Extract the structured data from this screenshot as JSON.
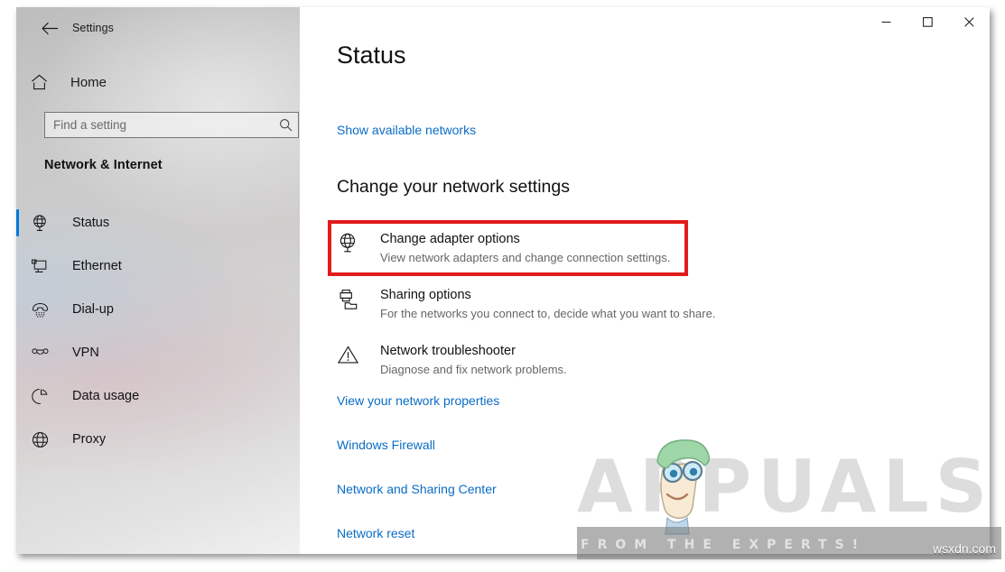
{
  "window": {
    "app_title": "Settings",
    "back_icon": "back-arrow-icon",
    "controls": {
      "minimize": "minimize-icon",
      "maximize": "maximize-icon",
      "close": "close-icon"
    }
  },
  "sidebar": {
    "home_label": "Home",
    "home_icon": "home-icon",
    "search": {
      "placeholder": "Find a setting",
      "value": "",
      "icon": "search-icon"
    },
    "category": "Network & Internet",
    "items": [
      {
        "label": "Status",
        "icon": "globe-monitor-icon",
        "selected": true
      },
      {
        "label": "Ethernet",
        "icon": "ethernet-icon",
        "selected": false
      },
      {
        "label": "Dial-up",
        "icon": "dialup-phone-icon",
        "selected": false
      },
      {
        "label": "VPN",
        "icon": "vpn-key-icon",
        "selected": false
      },
      {
        "label": "Data usage",
        "icon": "pie-chart-icon",
        "selected": false
      },
      {
        "label": "Proxy",
        "icon": "globe-icon",
        "selected": false
      }
    ],
    "accent_color": "#0078d7"
  },
  "main": {
    "page_title": "Status",
    "top_link": "Show available networks",
    "section_heading": "Change your network settings",
    "options": [
      {
        "title": "Change adapter options",
        "description": "View network adapters and change connection settings.",
        "icon": "globe-monitor-icon",
        "highlighted": true
      },
      {
        "title": "Sharing options",
        "description": "For the networks you connect to, decide what you want to share.",
        "icon": "printer-folder-icon",
        "highlighted": false
      },
      {
        "title": "Network troubleshooter",
        "description": "Diagnose and fix network problems.",
        "icon": "warning-triangle-icon",
        "highlighted": false
      }
    ],
    "links": [
      "View your network properties",
      "Windows Firewall",
      "Network and Sharing Center",
      "Network reset"
    ],
    "link_color": "#0a6cc4",
    "highlight_color": "#e21b1b"
  },
  "watermark": {
    "brand": "APPUALS",
    "tagline": "FROM THE EXPERTS!",
    "site": "wsxdn.com"
  }
}
